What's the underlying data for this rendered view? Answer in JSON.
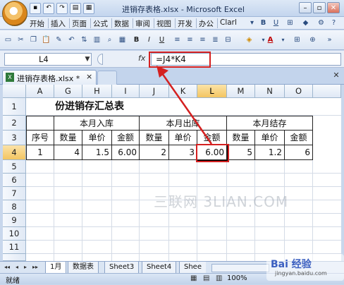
{
  "window": {
    "title": "进销存表格.xlsx - Microsoft Excel",
    "buttons": [
      "minimize",
      "maximize",
      "close"
    ]
  },
  "menubar": {
    "items": [
      "开始",
      "插入",
      "页面",
      "公式",
      "数据",
      "审阅",
      "视图",
      "开发",
      "办公",
      "Clarl"
    ]
  },
  "formula_bar": {
    "name_box": "L4",
    "fx": "fx",
    "formula": "=J4*K4"
  },
  "document_tab": {
    "label": "进销存表格.xlsx *"
  },
  "sheet": {
    "columns": [
      "A",
      "G",
      "H",
      "I",
      "J",
      "K",
      "L",
      "M",
      "N",
      "O"
    ],
    "selected_column": "L",
    "rows": [
      "1",
      "2",
      "3",
      "4",
      "5",
      "6",
      "7",
      "8",
      "9",
      "10",
      "11"
    ],
    "selected_row": "4",
    "title": "份进销存汇总表",
    "groups": [
      "本月入库",
      "本月出库",
      "本月结存"
    ],
    "headers": [
      "序号",
      "数量",
      "单价",
      "金额",
      "数量",
      "单价",
      "金额",
      "数量",
      "单价",
      "金额"
    ],
    "row4": [
      "1",
      "4",
      "1.5",
      "6.00",
      "2",
      "3",
      "6.00",
      "5",
      "1.2",
      "6"
    ]
  },
  "sheet_tabs": {
    "nav": [
      "◂◂",
      "◂",
      "▸",
      "▸▸"
    ],
    "tabs": [
      "1月",
      "数据表",
      "Sheet3",
      "Sheet4",
      "Shee"
    ],
    "active_index": 0
  },
  "statusbar": {
    "ready": "就绪",
    "zoom": "100%"
  },
  "watermark": {
    "text": "三联网 3LIAN.COM",
    "badge": "Bai 经验",
    "badge_sub": "jingyan.baidu.com"
  },
  "colors": {
    "annotation_red": "#d42020",
    "selection_gold": "#f3c561",
    "excel_blue": "#c3d4ec"
  }
}
